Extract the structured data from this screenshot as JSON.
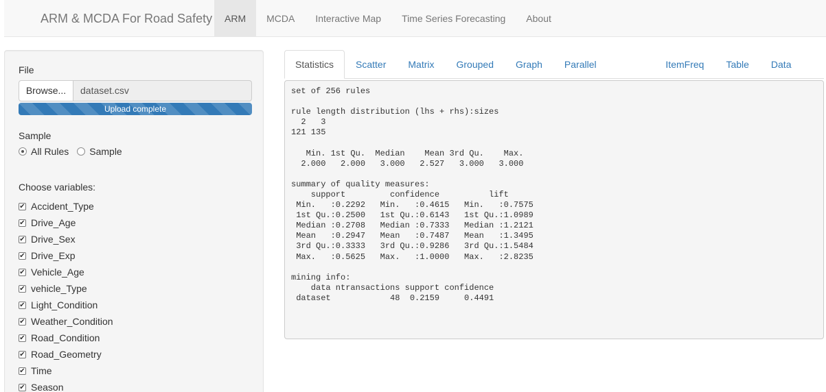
{
  "navbar": {
    "brand": "ARM & MCDA For Road Safety",
    "items": [
      {
        "label": "ARM",
        "active": true
      },
      {
        "label": "MCDA",
        "active": false
      },
      {
        "label": "Interactive Map",
        "active": false
      },
      {
        "label": "Time Series Forecasting",
        "active": false
      },
      {
        "label": "About",
        "active": false
      }
    ]
  },
  "sidebar": {
    "file": {
      "label": "File",
      "browse_label": "Browse...",
      "file_name": "dataset.csv",
      "progress_text": "Upload complete",
      "progress_fraction": 1.0,
      "accent": "#337ab7"
    },
    "sample": {
      "label": "Sample",
      "options": [
        {
          "label": "All Rules",
          "checked": true
        },
        {
          "label": "Sample",
          "checked": false
        }
      ]
    },
    "variables": {
      "label": "Choose variables:",
      "items": [
        {
          "label": "Accident_Type",
          "checked": true
        },
        {
          "label": "Drive_Age",
          "checked": true
        },
        {
          "label": "Drive_Sex",
          "checked": true
        },
        {
          "label": "Drive_Exp",
          "checked": true
        },
        {
          "label": "Vehicle_Age",
          "checked": true
        },
        {
          "label": "vehicle_Type",
          "checked": true
        },
        {
          "label": "Light_Condition",
          "checked": true
        },
        {
          "label": "Weather_Condition",
          "checked": true
        },
        {
          "label": "Road_Condition",
          "checked": true
        },
        {
          "label": "Road_Geometry",
          "checked": true
        },
        {
          "label": "Time",
          "checked": true
        },
        {
          "label": "Season",
          "checked": true
        }
      ]
    }
  },
  "main": {
    "tabs": [
      {
        "label": "Statistics",
        "active": true
      },
      {
        "label": "Scatter",
        "active": false
      },
      {
        "label": "Matrix",
        "active": false
      },
      {
        "label": "Grouped",
        "active": false
      },
      {
        "label": "Graph",
        "active": false
      },
      {
        "label": "Parallel Coordinates",
        "active": false
      },
      {
        "label": "ItemFreq",
        "active": false
      },
      {
        "label": "Table",
        "active": false
      },
      {
        "label": "Data Table",
        "active": false
      }
    ],
    "output_lines": [
      "set of 256 rules",
      "",
      "rule length distribution (lhs + rhs):sizes",
      "  2   3 ",
      "121 135 ",
      "",
      "   Min. 1st Qu.  Median    Mean 3rd Qu.    Max. ",
      "  2.000   2.000   3.000   2.527   3.000   3.000 ",
      "",
      "summary of quality measures:",
      "    support         confidence          lift       ",
      " Min.   :0.2292   Min.   :0.4615   Min.   :0.7575  ",
      " 1st Qu.:0.2500   1st Qu.:0.6143   1st Qu.:1.0989  ",
      " Median :0.2708   Median :0.7333   Median :1.2121  ",
      " Mean   :0.2947   Mean   :0.7487   Mean   :1.3495  ",
      " 3rd Qu.:0.3333   3rd Qu.:0.9286   3rd Qu.:1.5484  ",
      " Max.   :0.5625   Max.   :1.0000   Max.   :2.8235  ",
      "",
      "mining info:",
      "    data ntransactions support confidence",
      " dataset            48  0.2159     0.4491"
    ]
  }
}
